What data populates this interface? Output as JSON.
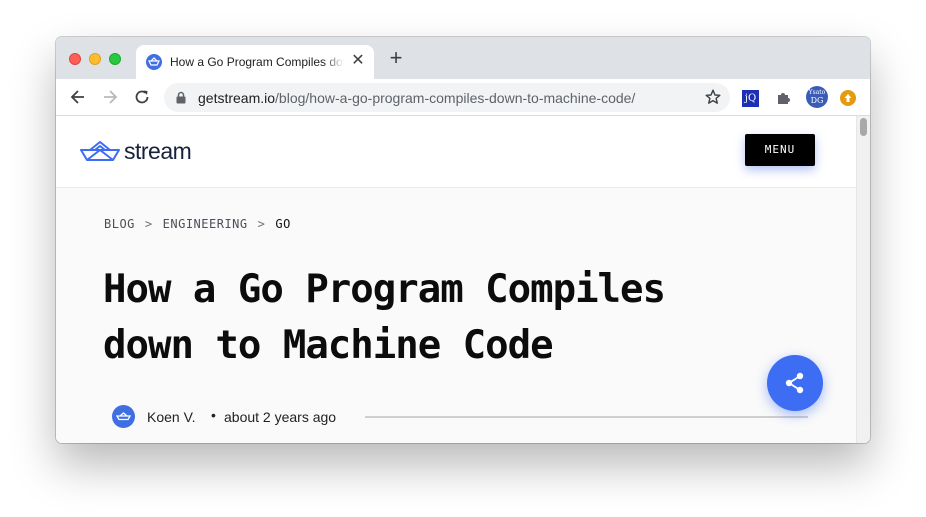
{
  "browser": {
    "tab": {
      "title": "How a Go Program Compiles down to Machine Code",
      "close_glyph": "✕"
    },
    "new_tab_glyph": "+",
    "url": {
      "domain": "getstream.io",
      "path": "/blog/how-a-go-program-compiles-down-to-machine-code/"
    },
    "extensions": {
      "jq_label": "jQ",
      "avatar_line1": "Ysato",
      "avatar_line2": "DG"
    }
  },
  "site": {
    "logo_text": "stream",
    "menu_label": "MENU",
    "brand_color": "#3d6df2"
  },
  "article": {
    "breadcrumb": [
      "BLOG",
      "ENGINEERING",
      "GO"
    ],
    "breadcrumb_separator": ">",
    "title_line1": "How a Go Program Compiles",
    "title_line2": "down to Machine Code",
    "author_name": "Koen V.",
    "bullet": "•",
    "published": "about 2 years ago"
  }
}
